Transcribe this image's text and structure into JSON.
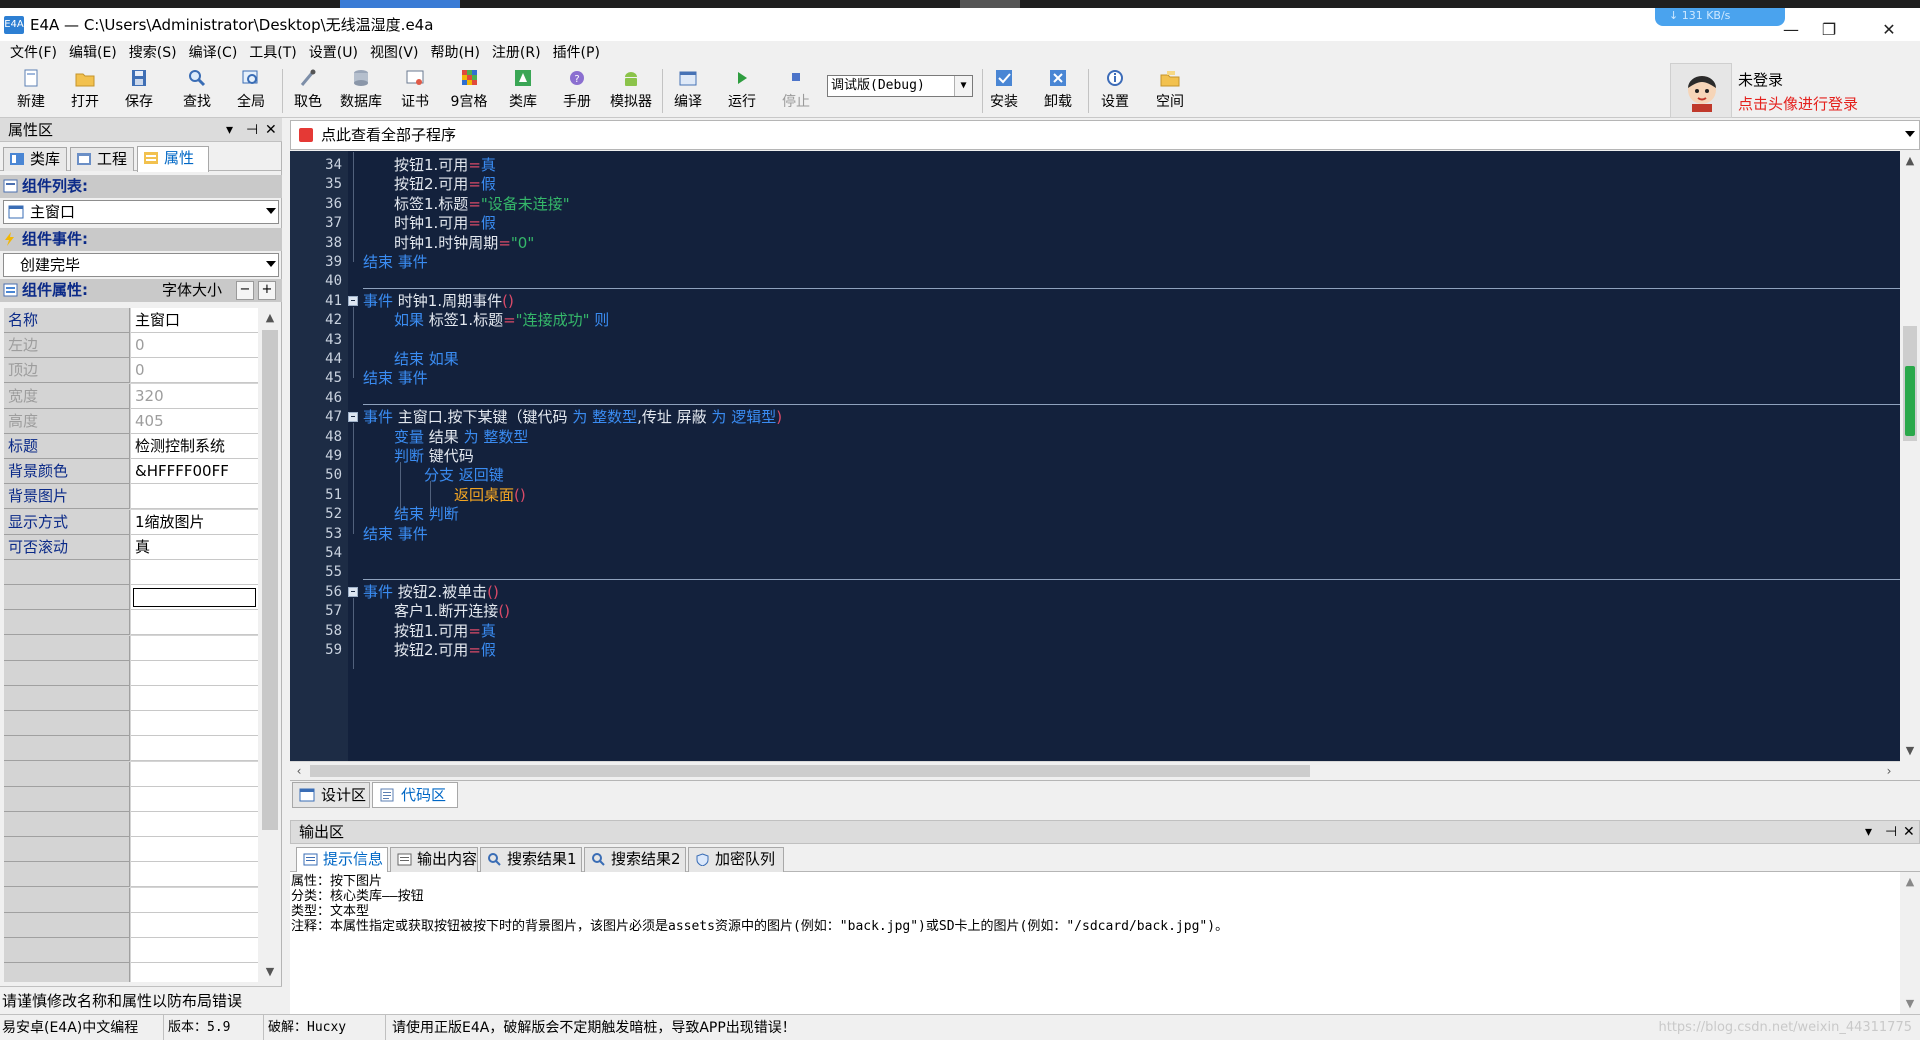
{
  "window": {
    "title": "E4A — C:\\Users\\Administrator\\Desktop\\无线温湿度.e4a",
    "icon_label": "E4A",
    "speed_badge": "↓ 131 KB/s",
    "controls": {
      "minimize": "—",
      "restore": "❐",
      "close": "✕"
    }
  },
  "menu": [
    "文件(F)",
    "编辑(E)",
    "搜索(S)",
    "编译(C)",
    "工具(T)",
    "设置(U)",
    "视图(V)",
    "帮助(H)",
    "注册(R)",
    "插件(P)"
  ],
  "toolbar": {
    "buttons": [
      {
        "label": "新建",
        "icon": "new-file-icon"
      },
      {
        "label": "打开",
        "icon": "open-folder-icon"
      },
      {
        "label": "保存",
        "icon": "save-icon"
      },
      {
        "label": "查找",
        "icon": "search-icon"
      },
      {
        "label": "全局",
        "icon": "global-search-icon"
      },
      {
        "label": "取色",
        "icon": "color-picker-icon"
      },
      {
        "label": "数据库",
        "icon": "database-icon"
      },
      {
        "label": "证书",
        "icon": "certificate-icon"
      },
      {
        "label": "9宫格",
        "icon": "nine-grid-icon"
      },
      {
        "label": "类库",
        "icon": "library-icon"
      },
      {
        "label": "手册",
        "icon": "manual-icon"
      },
      {
        "label": "模拟器",
        "icon": "android-emulator-icon"
      },
      {
        "label": "编译",
        "icon": "compile-icon"
      },
      {
        "label": "运行",
        "icon": "run-icon"
      },
      {
        "label": "停止",
        "icon": "stop-icon"
      },
      {
        "label": "安装",
        "icon": "install-icon"
      },
      {
        "label": "卸载",
        "icon": "uninstall-icon"
      },
      {
        "label": "设置",
        "icon": "settings-icon"
      },
      {
        "label": "空间",
        "icon": "space-icon"
      }
    ],
    "build_mode": "调试版(Debug)"
  },
  "account": {
    "status": "未登录",
    "hint": "点击头像进行登录",
    "hint_color": "#e4211d"
  },
  "left_panel": {
    "title": "属性区",
    "head_controls": {
      "dropdown": "▾",
      "pin": "⊣",
      "close": "✕"
    },
    "tabs": [
      "类库",
      "工程",
      "属性"
    ],
    "active_tab": "属性",
    "component_list_label": "组件列表:",
    "component_selected": "主窗口",
    "component_events_label": "组件事件:",
    "event_selected": "创建完毕",
    "component_props_label": "组件属性:",
    "font_size_label": "字体大小",
    "font_minus": "−",
    "font_plus": "+",
    "properties": [
      {
        "name": "名称",
        "value": "主窗口",
        "state": "link"
      },
      {
        "name": "左边",
        "value": "0",
        "state": "dim"
      },
      {
        "name": "顶边",
        "value": "0",
        "state": "dim"
      },
      {
        "name": "宽度",
        "value": "320",
        "state": "dim"
      },
      {
        "name": "高度",
        "value": "405",
        "state": "dim"
      },
      {
        "name": "标题",
        "value": "检测控制系统",
        "state": "link"
      },
      {
        "name": "背景颜色",
        "value": "&HFFFF00FF",
        "state": "link"
      },
      {
        "name": "背景图片",
        "value": "",
        "state": "link"
      },
      {
        "name": "显示方式",
        "value": "1缩放图片",
        "state": "link"
      },
      {
        "name": "可否滚动",
        "value": "真",
        "state": "link"
      }
    ],
    "footer_note": "请谨慎修改名称和属性以防布局错误"
  },
  "editor": {
    "subroutine_selector": "点此查看全部子程序",
    "accent_bg": "#13213c",
    "lines": [
      {
        "n": "34",
        "indent": 1,
        "parts": [
          [
            "t",
            "按钮1.可用"
          ],
          [
            "op",
            "="
          ],
          [
            "kw",
            "真"
          ]
        ]
      },
      {
        "n": "35",
        "indent": 1,
        "parts": [
          [
            "t",
            "按钮2.可用"
          ],
          [
            "op",
            "="
          ],
          [
            "kw",
            "假"
          ]
        ]
      },
      {
        "n": "36",
        "indent": 1,
        "parts": [
          [
            "t",
            "标签1.标题"
          ],
          [
            "op",
            "="
          ],
          [
            "str",
            "\"设备未连接\""
          ]
        ]
      },
      {
        "n": "37",
        "indent": 1,
        "parts": [
          [
            "t",
            "时钟1.可用"
          ],
          [
            "op",
            "="
          ],
          [
            "kw",
            "假"
          ]
        ]
      },
      {
        "n": "38",
        "indent": 1,
        "parts": [
          [
            "t",
            "时钟1.时钟周期"
          ],
          [
            "op",
            "="
          ],
          [
            "str",
            "\"0\""
          ]
        ]
      },
      {
        "n": "39",
        "indent": 0,
        "parts": [
          [
            "kw",
            "结束 事件"
          ]
        ]
      },
      {
        "n": "40",
        "indent": 0,
        "parts": []
      },
      {
        "n": "41",
        "indent": 0,
        "fold": true,
        "parts": [
          [
            "kw",
            "事件 "
          ],
          [
            "t",
            "时钟1.周期事件"
          ],
          [
            "paren",
            "()"
          ]
        ]
      },
      {
        "n": "42",
        "indent": 1,
        "parts": [
          [
            "kw",
            "如果 "
          ],
          [
            "t",
            "标签1.标题"
          ],
          [
            "op",
            "="
          ],
          [
            "str",
            "\"连接成功\" "
          ],
          [
            "kw",
            "则"
          ]
        ]
      },
      {
        "n": "43",
        "indent": 0,
        "parts": []
      },
      {
        "n": "44",
        "indent": 1,
        "parts": [
          [
            "kw",
            "结束 如果"
          ]
        ]
      },
      {
        "n": "45",
        "indent": 0,
        "parts": [
          [
            "kw",
            "结束 事件"
          ]
        ]
      },
      {
        "n": "46",
        "indent": 0,
        "parts": []
      },
      {
        "n": "47",
        "indent": 0,
        "fold": true,
        "parts": [
          [
            "kw",
            "事件 "
          ],
          [
            "t",
            "主窗口.按下某键（键代码 "
          ],
          [
            "kw",
            "为 整数型"
          ],
          [
            "t",
            ",传址 屏蔽 "
          ],
          [
            "kw",
            "为 逻辑型"
          ],
          [
            "paren",
            ")"
          ]
        ]
      },
      {
        "n": "48",
        "indent": 1,
        "parts": [
          [
            "kw",
            "变量 "
          ],
          [
            "t",
            "结果 "
          ],
          [
            "kw",
            "为 整数型"
          ]
        ]
      },
      {
        "n": "49",
        "indent": 1,
        "parts": [
          [
            "kw",
            "判断 "
          ],
          [
            "t",
            "键代码"
          ]
        ]
      },
      {
        "n": "50",
        "indent": 2,
        "parts": [
          [
            "kw",
            "分支 "
          ],
          [
            "kw",
            "返回键"
          ]
        ]
      },
      {
        "n": "51",
        "indent": 3,
        "parts": [
          [
            "fn",
            "返回桌面"
          ],
          [
            "paren",
            "()"
          ]
        ]
      },
      {
        "n": "52",
        "indent": 1,
        "parts": [
          [
            "kw",
            "结束 判断"
          ]
        ]
      },
      {
        "n": "53",
        "indent": 0,
        "parts": [
          [
            "kw",
            "结束 事件"
          ]
        ]
      },
      {
        "n": "54",
        "indent": 0,
        "parts": []
      },
      {
        "n": "55",
        "indent": 0,
        "parts": []
      },
      {
        "n": "56",
        "indent": 0,
        "fold": true,
        "parts": [
          [
            "kw",
            "事件 "
          ],
          [
            "t",
            "按钮2.被单击"
          ],
          [
            "paren",
            "()"
          ]
        ]
      },
      {
        "n": "57",
        "indent": 1,
        "parts": [
          [
            "t",
            "客户1.断开连接"
          ],
          [
            "paren",
            "()"
          ]
        ]
      },
      {
        "n": "58",
        "indent": 1,
        "parts": [
          [
            "t",
            "按钮1.可用"
          ],
          [
            "op",
            "="
          ],
          [
            "kw",
            "真"
          ]
        ]
      },
      {
        "n": "59",
        "indent": 1,
        "parts": [
          [
            "t",
            "按钮2.可用"
          ],
          [
            "op",
            "="
          ],
          [
            "kw",
            "假"
          ]
        ]
      }
    ],
    "view_tabs": [
      "设计区",
      "代码区"
    ],
    "active_view": "代码区"
  },
  "output": {
    "title": "输出区",
    "tabs": [
      "提示信息",
      "输出内容",
      "搜索结果1",
      "搜索结果2",
      "加密队列"
    ],
    "active_tab": "提示信息",
    "lines": [
      "属性：按下图片",
      "分类：核心类库——按钮",
      "类型：文本型",
      "注释：本属性指定或获取按钮被按下时的背景图片，该图片必须是assets资源中的图片(例如：\"back.jpg\")或SD卡上的图片(例如：\"/sdcard/back.jpg\")。"
    ]
  },
  "statusbar": {
    "product": "易安卓(E4A)中文编程",
    "version": "版本：5.9",
    "crack": "破解：Hucxy",
    "warning": "请使用正版E4A，破解版会不定期触发暗桩，导致APP出现错误！",
    "watermark": "https://blog.csdn.net/weixin_44311775"
  }
}
